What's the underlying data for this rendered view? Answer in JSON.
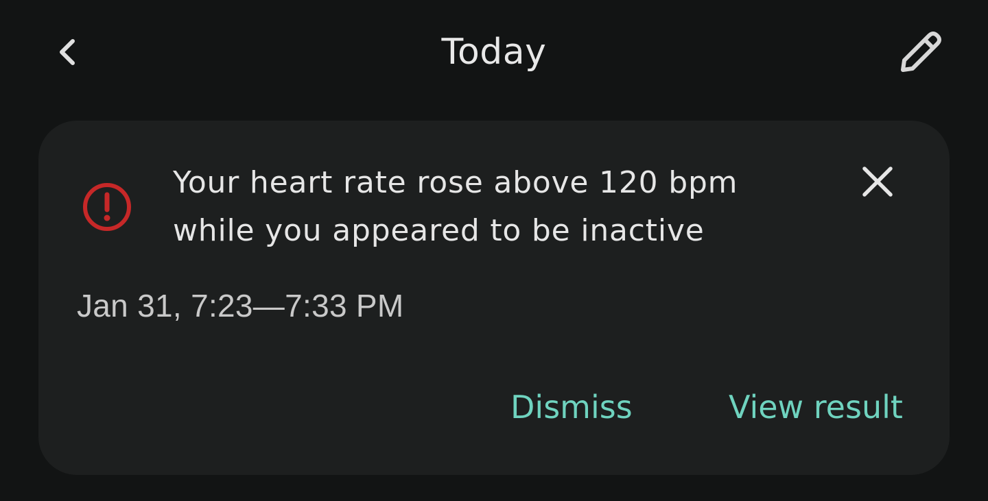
{
  "header": {
    "title": "Today",
    "back_icon": "chevron-left-icon",
    "edit_icon": "pencil-icon"
  },
  "alert_card": {
    "icon": "alert-circle-icon",
    "icon_color": "#c62828",
    "message_line1": "Your heart rate rose above 120 bpm",
    "message_line2": "while you appeared to be inactive",
    "close_icon": "close-icon",
    "time_range": "Jan 31, 7:23—7:33 PM",
    "actions": {
      "dismiss_label": "Dismiss",
      "view_result_label": "View result"
    }
  },
  "colors": {
    "background": "#121414",
    "card": "#1d1f1f",
    "accent": "#6fd3bf",
    "alert": "#c62828"
  }
}
